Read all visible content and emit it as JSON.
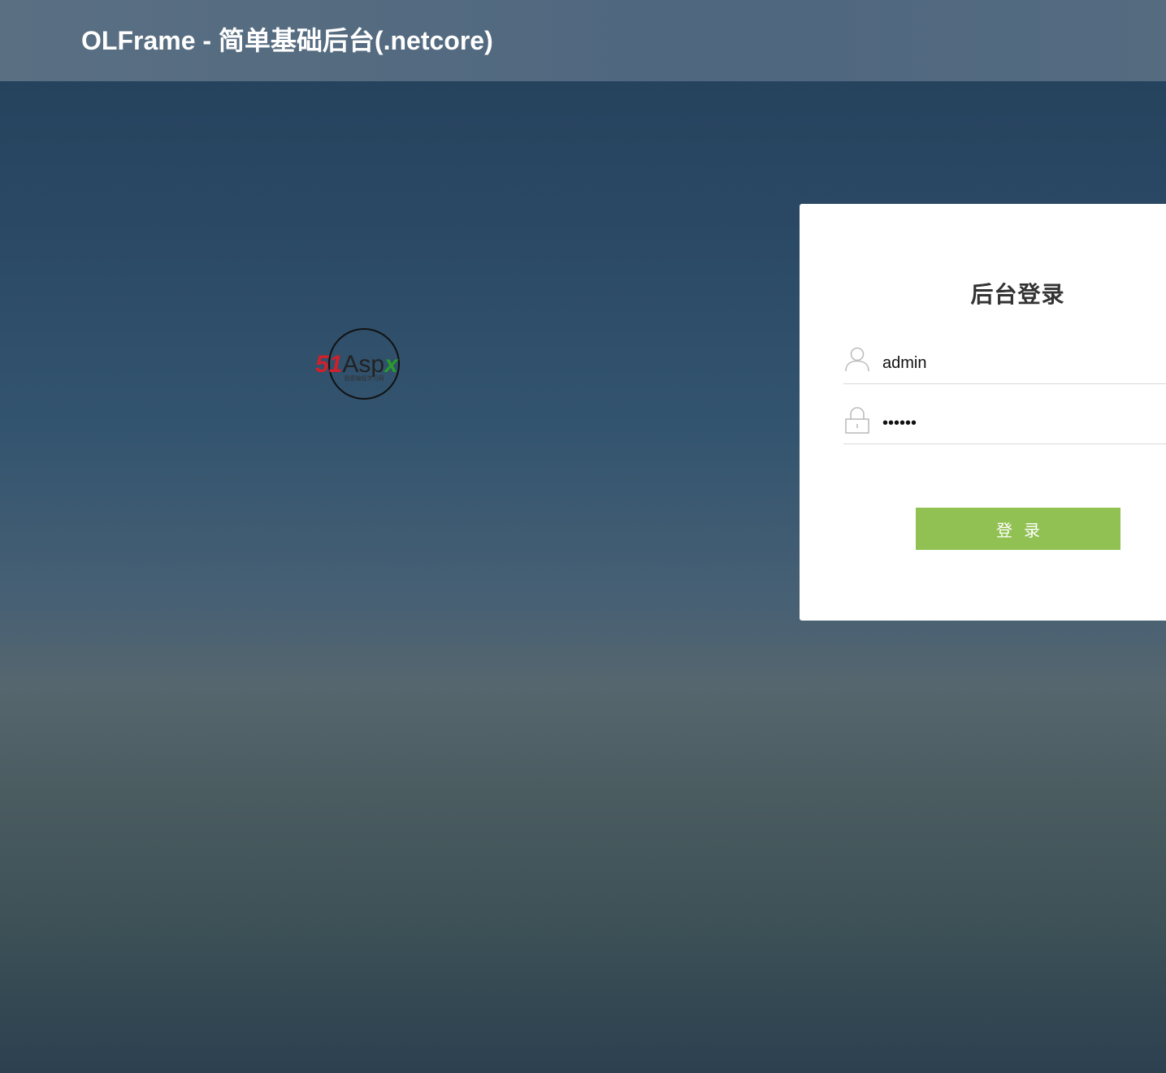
{
  "header": {
    "title": "OLFrame - 简单基础后台(.netcore)"
  },
  "logo": {
    "text_main_red": "51",
    "text_main_dark": "Asp",
    "text_main_green": "x",
    "text_sub": "我爱编程学习网"
  },
  "login": {
    "title": "后台登录",
    "username": {
      "value": "admin",
      "icon": "user-icon"
    },
    "password": {
      "value": "••••••",
      "icon": "lock-icon"
    },
    "submit_label": "登录"
  },
  "colors": {
    "accent_button": "#92c153",
    "panel_bg": "#ffffff",
    "header_bg": "#546b80",
    "logo_red": "#d0202a",
    "logo_green": "#2a9a2a"
  }
}
